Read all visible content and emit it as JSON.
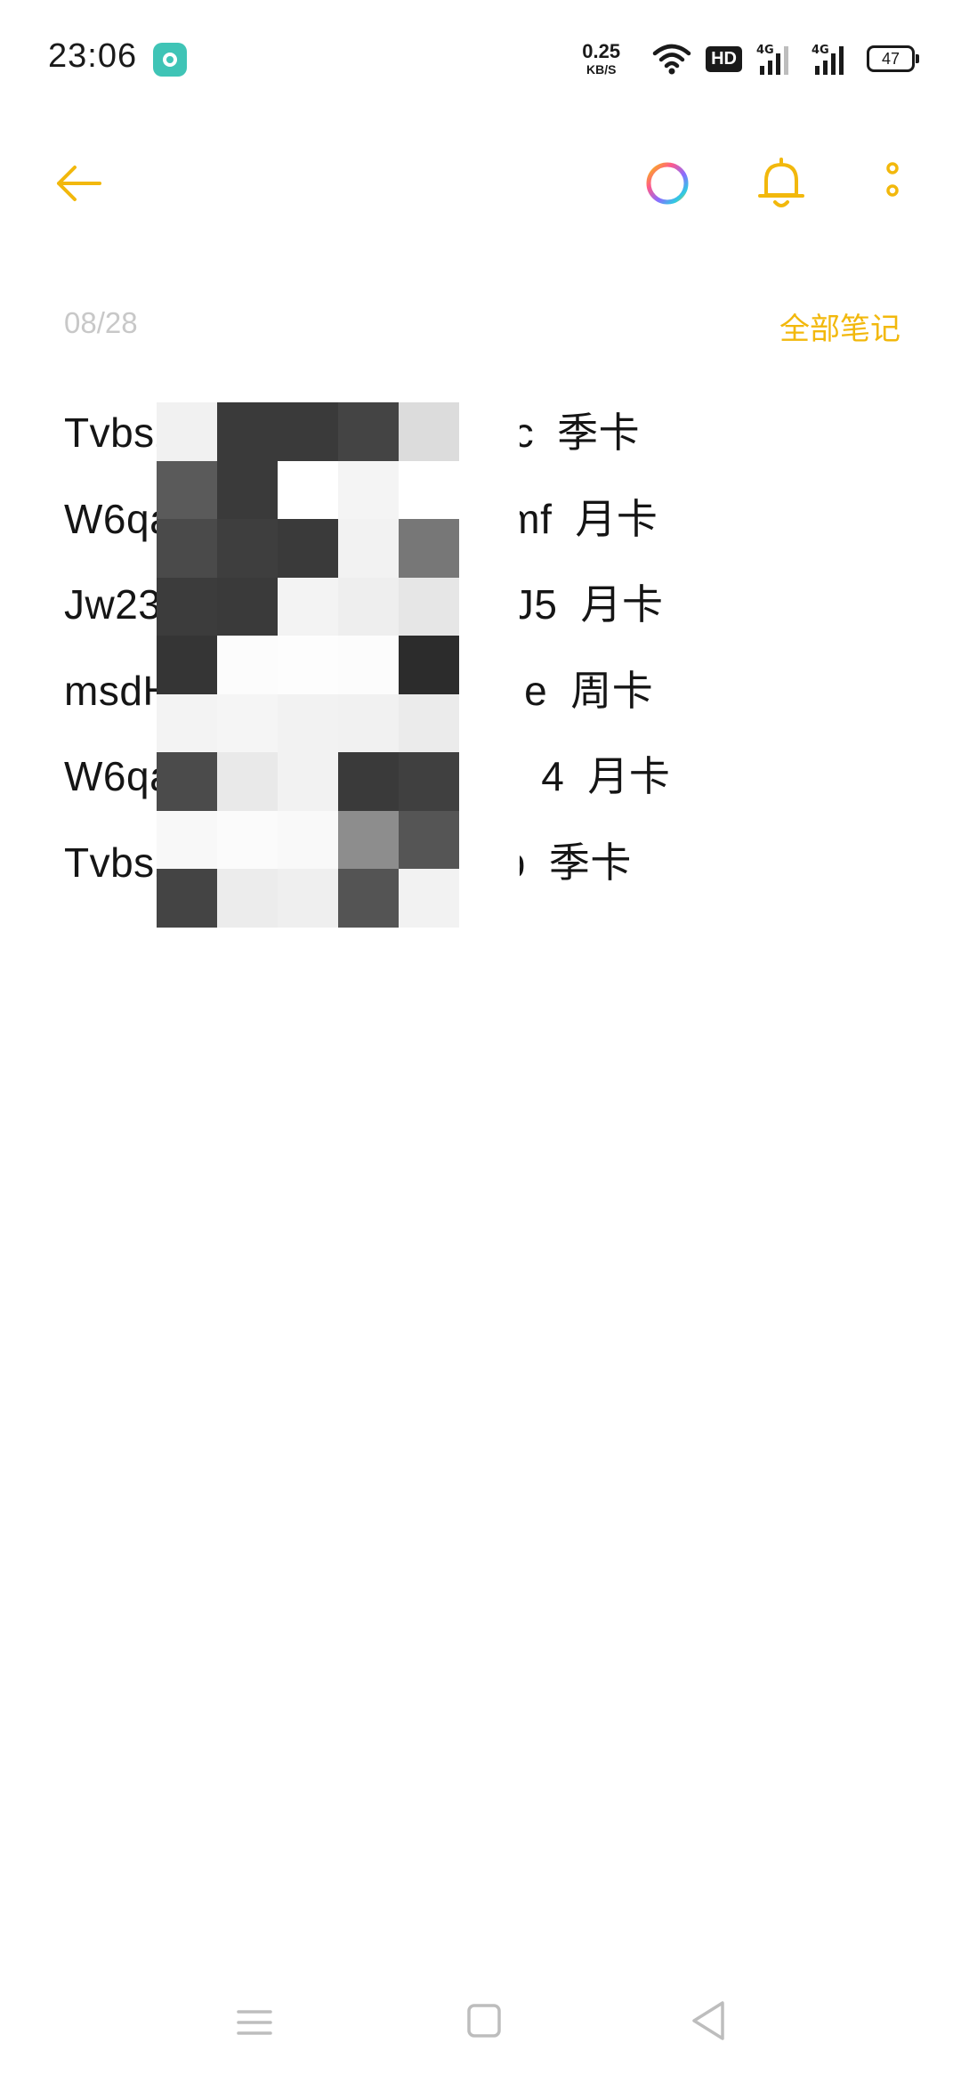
{
  "status_bar": {
    "time": "23:06",
    "net_speed_value": "0.25",
    "net_speed_unit": "KB/S",
    "hd_label": "HD",
    "signal_1_label": "4G",
    "signal_2_label": "4G",
    "battery": "47",
    "icons": [
      "notes-app-icon",
      "wifi-icon",
      "hd-icon",
      "signal-icon",
      "signal-icon",
      "battery-icon"
    ]
  },
  "toolbar": {
    "icons": [
      "back-arrow-icon",
      "color-ring-icon",
      "bell-icon",
      "more-vertical-icon"
    ],
    "accent": "#f2b80c"
  },
  "note": {
    "date": "08/28",
    "all_notes_label": "全部笔记",
    "lines": [
      {
        "head": "Tvbs2",
        "tail": "5ic",
        "card": "季卡"
      },
      {
        "head": "W6qa",
        "tail": "6mf",
        "card": "月卡"
      },
      {
        "head": "Jw23v",
        "tail": "J5",
        "card": "月卡"
      },
      {
        "head": "msdH",
        "tail": "e",
        "card": "周卡"
      },
      {
        "head": "W6qaL",
        "tail": "4",
        "card": "月卡"
      },
      {
        "head": "Tvbs2",
        "tail": "b",
        "card": "季卡"
      }
    ]
  },
  "colors": {
    "accent": "#f2b80c",
    "date_gray": "#c8c8c8",
    "text": "#151515"
  },
  "nav_bar": {
    "icons": [
      "menu-icon",
      "home-square-icon",
      "back-triangle-icon"
    ]
  }
}
